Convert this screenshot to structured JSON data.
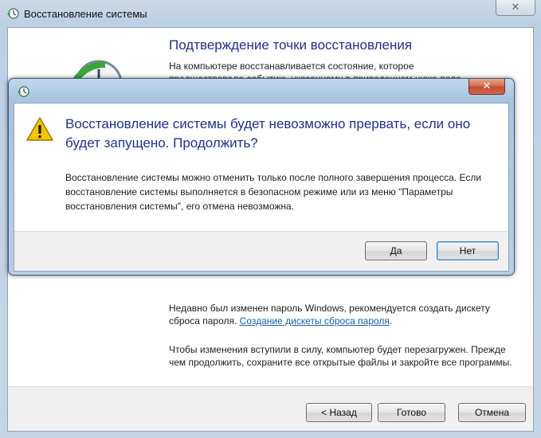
{
  "main_window": {
    "title": "Восстановление системы",
    "close_glyph": "✕",
    "content_title": "Подтверждение точки восстановления",
    "content_desc_line1": "На компьютере восстанавливается состояние, которое",
    "content_desc_line2": "предшествовало событию, указанному в приведенном ниже поле",
    "info_password_text": "Недавно был изменен пароль Windows, рекомендуется создать дискету сброса пароля.",
    "info_password_link": "Создание дискеты сброса пароля",
    "info_password_tail": ".",
    "info_restart": "Чтобы изменения вступили в силу, компьютер будет перезагружен. Прежде чем продолжить, сохраните все открытые файлы и закройте все программы.",
    "buttons": {
      "back": "< Назад",
      "done": "Готово",
      "cancel": "Отмена"
    }
  },
  "dialog": {
    "close_glyph": "✕",
    "heading": "Восстановление системы будет невозможно прервать, если оно будет запущено. Продолжить?",
    "body": "Восстановление системы можно отменить только после полного завершения процесса. Если восстановление системы выполняется в безопасном режиме или из меню \"Параметры восстановления системы\", его отмена невозможна.",
    "buttons": {
      "yes": "Да",
      "no": "Нет"
    },
    "default_button": "no"
  },
  "icons": {
    "app": "system-restore-icon",
    "warning": "warning-icon",
    "graphic": "restore-clock-icon"
  },
  "colors": {
    "heading_blue": "#1e3287",
    "link_blue": "#1561a8",
    "close_red": "#c04a30"
  }
}
